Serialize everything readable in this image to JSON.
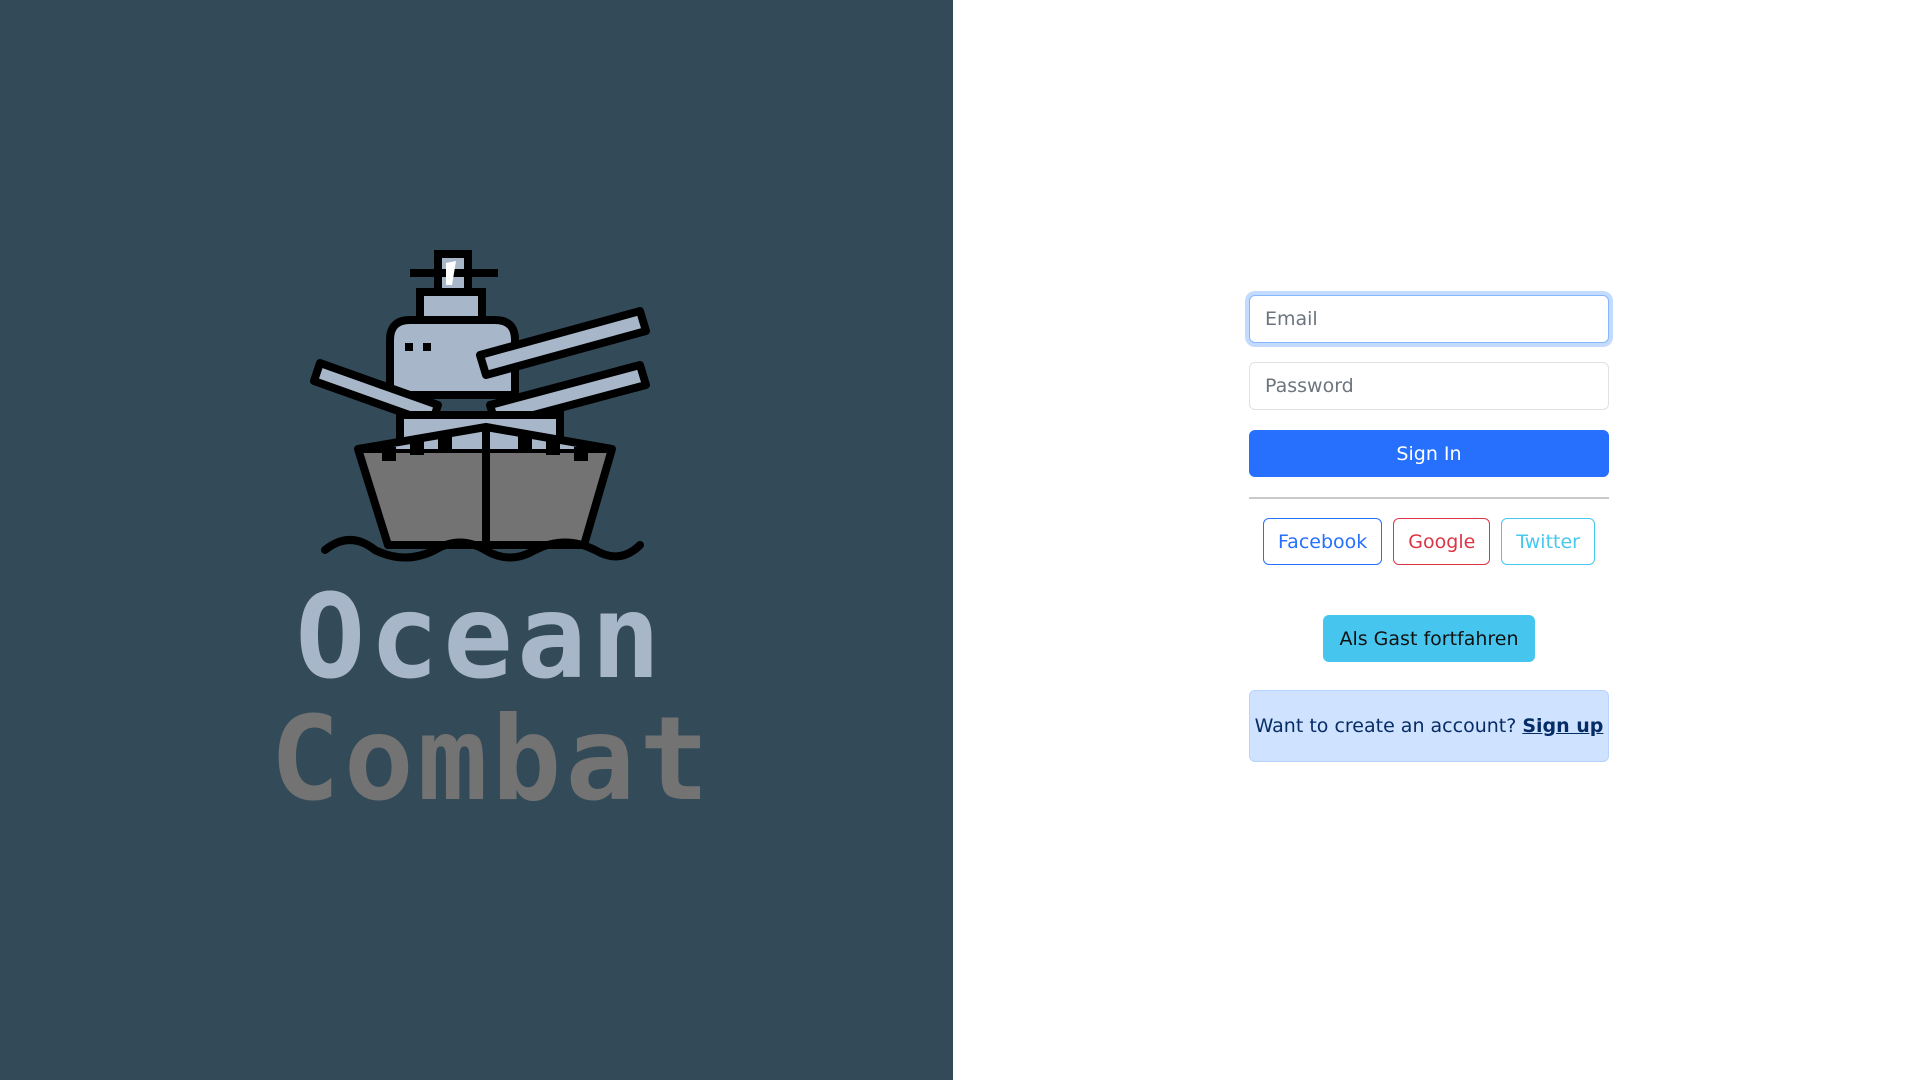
{
  "brand": {
    "line1": "Ocean",
    "line2": "Combat"
  },
  "login": {
    "email_placeholder": "Email",
    "password_placeholder": "Password",
    "sign_in_label": "Sign In"
  },
  "social": {
    "facebook_label": "Facebook",
    "google_label": "Google",
    "twitter_label": "Twitter"
  },
  "guest": {
    "label": "Als Gast fortfahren"
  },
  "signup": {
    "prompt": "Want to create an account?",
    "link_label": "Sign up"
  },
  "colors": {
    "left_panel": "#334b59",
    "primary": "#2670fd",
    "danger": "#dc3545",
    "info": "#48c8ee",
    "logo_top": "#a7b7c9",
    "logo_bottom": "#737373"
  }
}
